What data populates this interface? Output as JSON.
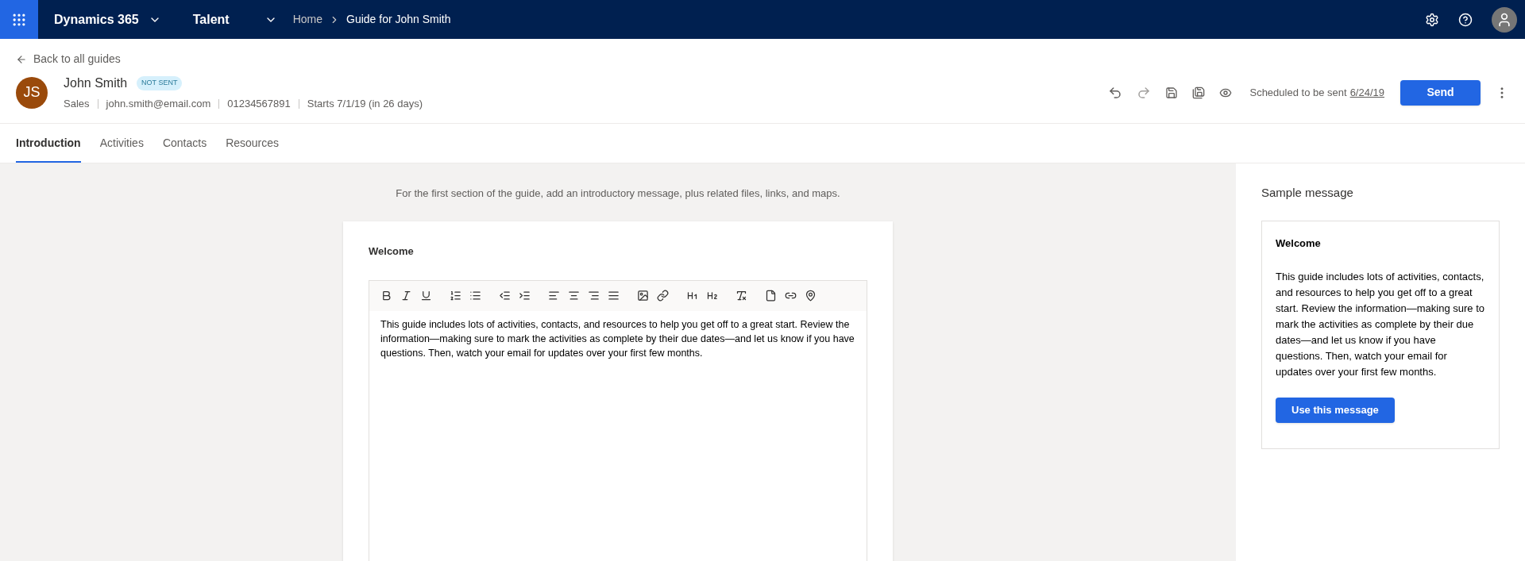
{
  "topbar": {
    "app": "Dynamics 365",
    "module": "Talent",
    "breadcrumb": [
      "Home",
      "Guide for John Smith"
    ]
  },
  "header": {
    "back": "Back to all guides",
    "initials": "JS",
    "name": "John Smith",
    "badge": "NOT SENT",
    "meta": [
      "Sales",
      "john.smith@email.com",
      "01234567891",
      "Starts 7/1/19 (in 26 days)"
    ],
    "schedule_text": "Scheduled to be sent",
    "schedule_date": "6/24/19",
    "send": "Send"
  },
  "tabs": [
    {
      "label": "Introduction",
      "selected": true
    },
    {
      "label": "Activities",
      "selected": false
    },
    {
      "label": "Contacts",
      "selected": false
    },
    {
      "label": "Resources",
      "selected": false
    }
  ],
  "hint": "For the first section of the guide, add an introductory message, plus related files, links, and maps.",
  "editor": {
    "title": "Welcome",
    "body": "This guide includes lots of activities, contacts, and resources to help you get off to a great start. Review the information—making sure to mark the activities as complete by their due dates—and let us know if you have questions. Then, watch your email for updates over your first few months."
  },
  "sample": {
    "heading": "Sample message",
    "title": "Welcome",
    "body": "This guide includes lots of activities, contacts, and resources to help you get off to a great start. Review the information—making sure to mark the activities as complete by their due dates—and let us know if you have questions. Then, watch your email for updates over your first few months.",
    "button": "Use this message"
  }
}
